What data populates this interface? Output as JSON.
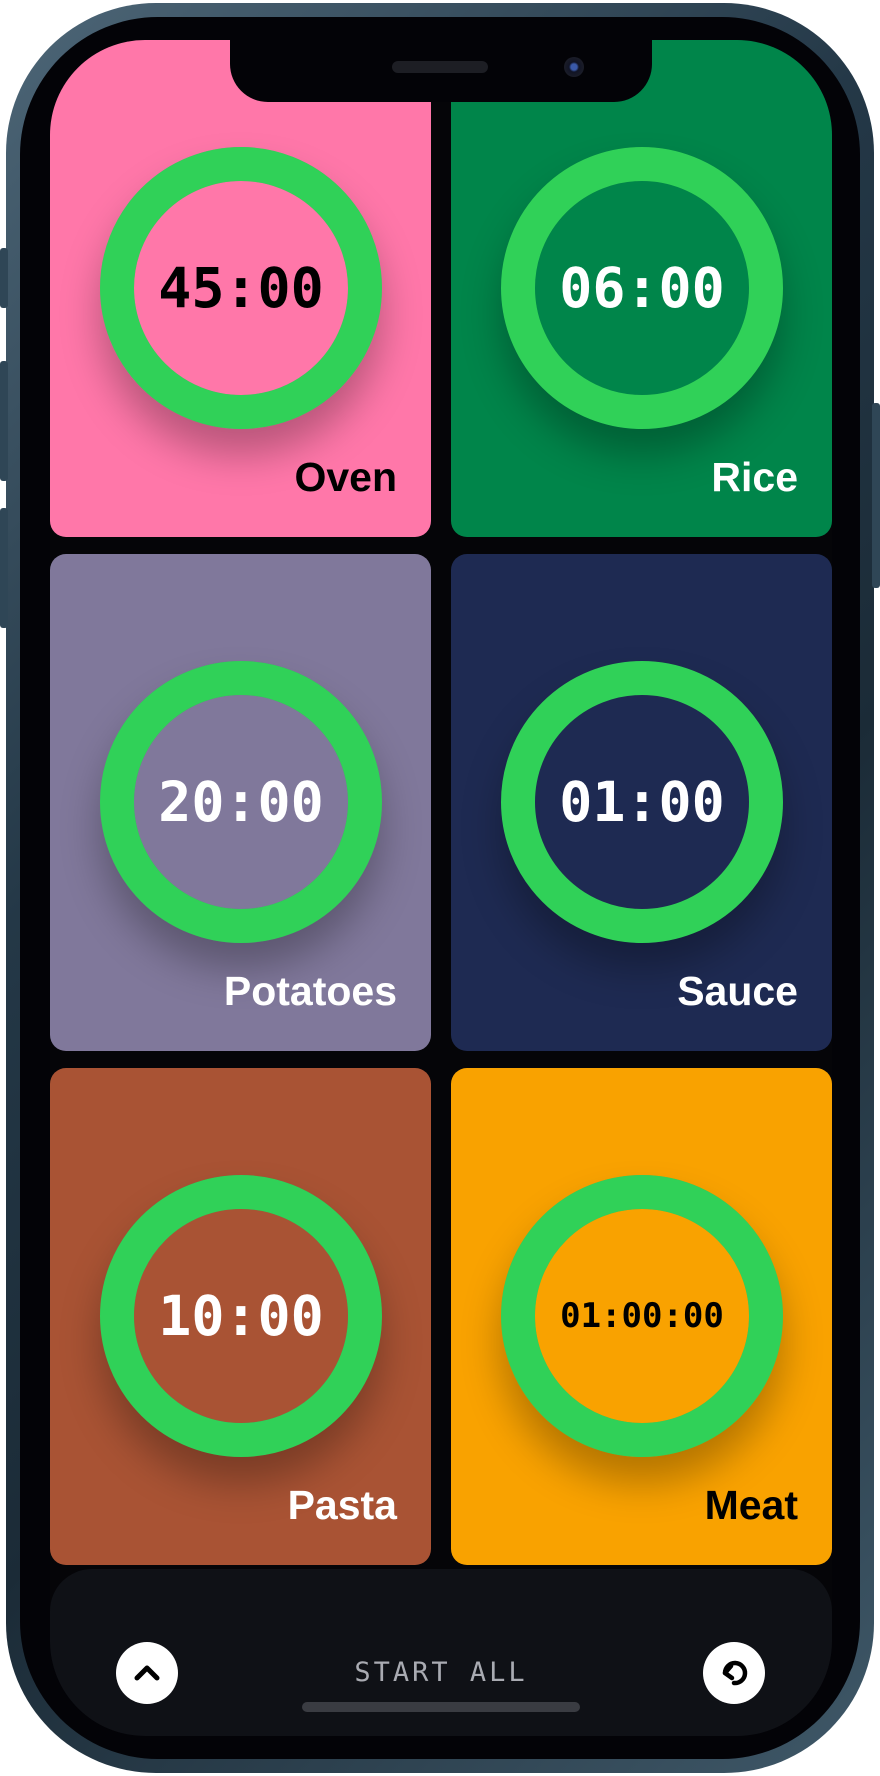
{
  "accent_color": "#30d158",
  "timers": [
    {
      "name": "Oven",
      "time": "45:00",
      "bg_color": "#ff77a9",
      "text_color": "#000000",
      "progress": 1.0
    },
    {
      "name": "Rice",
      "time": "06:00",
      "bg_color": "#00854a",
      "text_color": "#ffffff",
      "progress": 1.0
    },
    {
      "name": "Potatoes",
      "time": "20:00",
      "bg_color": "#80789b",
      "text_color": "#ffffff",
      "progress": 1.0
    },
    {
      "name": "Sauce",
      "time": "01:00",
      "bg_color": "#1e2a52",
      "text_color": "#ffffff",
      "progress": 1.0
    },
    {
      "name": "Pasta",
      "time": "10:00",
      "bg_color": "#a95334",
      "text_color": "#ffffff",
      "progress": 1.0
    },
    {
      "name": "Meat",
      "time": "01:00:00",
      "bg_color": "#f9a200",
      "text_color": "#000000",
      "progress": 1.0
    }
  ],
  "bottom_bar": {
    "start_all_label": "START ALL",
    "left_icon": "chevron-up-icon",
    "right_icon": "undo-arrow-icon"
  }
}
